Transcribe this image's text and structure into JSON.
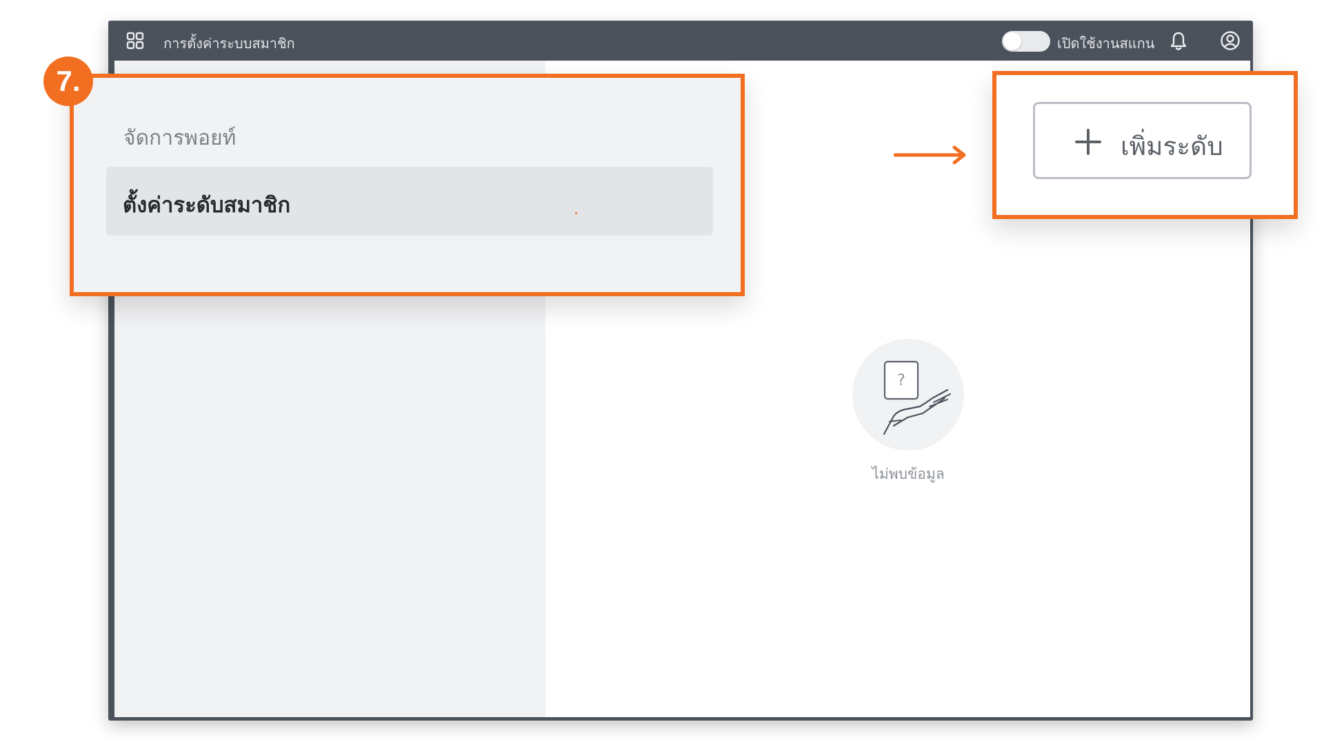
{
  "step": {
    "number": "7."
  },
  "header": {
    "apps_icon": "grid-icon",
    "title": "การตั้งค่าระบบสมาชิก",
    "scan_toggle_label": "เปิดใช้งานสแกน",
    "scan_toggle_on": false,
    "notification_icon": "bell-icon",
    "account_icon": "user-circle-icon"
  },
  "sidebar": {
    "section_heading": "จัดการพอยท์",
    "items": [
      {
        "label": "ตั้งค่าระดับสมาชิก",
        "selected": true
      }
    ]
  },
  "main": {
    "add_button_label": "เพิ่มระดับ",
    "add_button_icon": "plus-icon",
    "empty_state_text": "ไม่พบข้อมูล",
    "empty_state_icon": "hand-question-card-icon"
  },
  "colors": {
    "highlight": "#f26f21",
    "topbar": "#4b525c",
    "sidebar": "#f1f2f4",
    "selected_item": "#e2e4e8"
  }
}
